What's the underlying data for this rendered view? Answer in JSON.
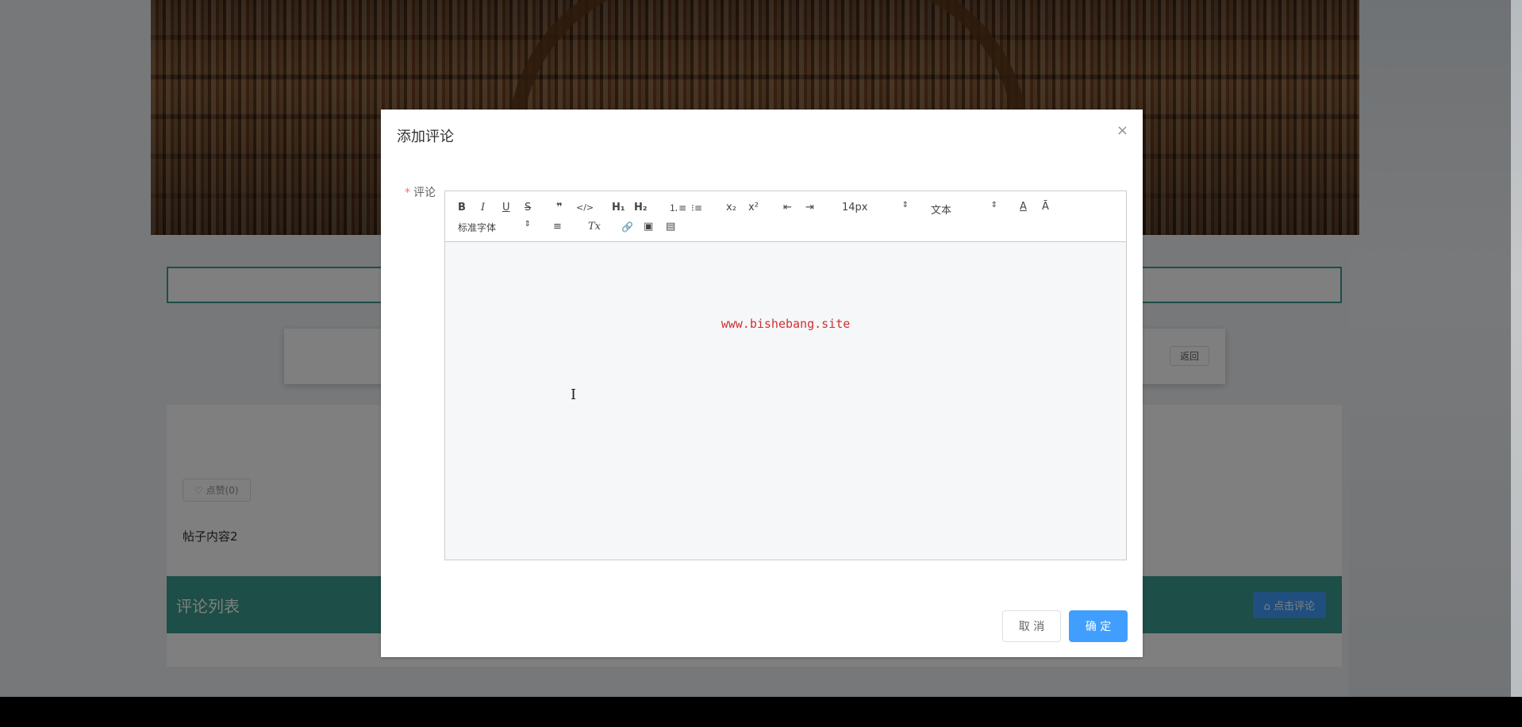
{
  "page": {
    "back_label": "返回",
    "like_label": "♡ 点赞(0)",
    "post_content": "帖子内容2",
    "comment_section_title": "评论列表",
    "comment_button_label": "⌂ 点击评论"
  },
  "dialog": {
    "title": "添加评论",
    "close_icon": "×",
    "field_label": "评论",
    "required_mark": "*",
    "cancel_label": "取 消",
    "confirm_label": "确 定"
  },
  "toolbar": {
    "bold": "B",
    "italic": "I",
    "underline": "U",
    "strike": "S",
    "blockquote": "❞",
    "code": "</>",
    "h1": "H₁",
    "h2": "H₂",
    "ordered_list": "⒈≡",
    "bullet_list": "⁝≡",
    "subscript": "x₂",
    "superscript": "x²",
    "outdent": "⇤",
    "indent": "⇥",
    "font_size": "14px",
    "header_select": "文本",
    "color": "A",
    "background": "Ā",
    "font_family": "标准字体",
    "align": "≡",
    "clean": "Tx",
    "link": "🔗",
    "image": "▣",
    "video": "▤",
    "picker_arrow": "⇕"
  },
  "editor": {
    "watermark": "www.bishebang.site",
    "cursor_glyph": "I"
  },
  "colors": {
    "primary": "#409eff",
    "teal": "#3a9d8f",
    "required": "#f56c6c",
    "watermark": "#d03030"
  }
}
